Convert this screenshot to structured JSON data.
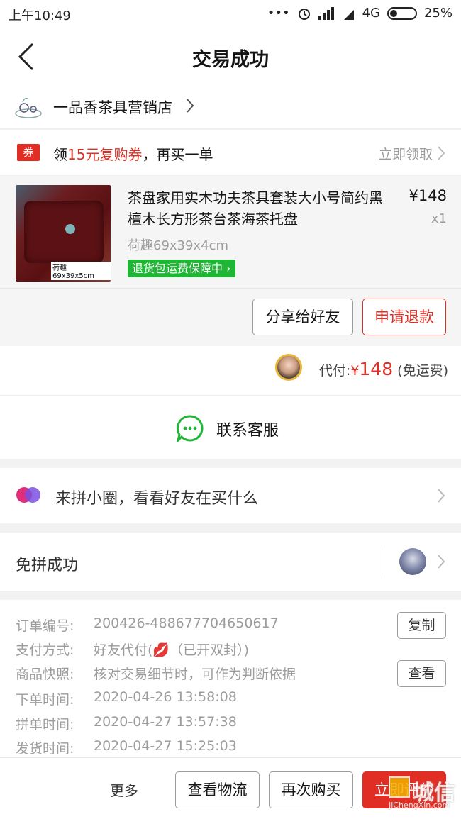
{
  "status_bar": {
    "time": "上午10:49",
    "network": "4G",
    "battery": "25%",
    "dots": "•••"
  },
  "nav": {
    "title": "交易成功"
  },
  "store": {
    "name": "一品香茶具营销店"
  },
  "coupon": {
    "tag": "券",
    "prefix": "领",
    "highlight": "15元复购券",
    "suffix": "，再买一单",
    "action": "立即领取"
  },
  "product": {
    "name": "茶盘家用实木功夫茶具套装大小号简约黑檀木长方形茶台茶海茶托盘",
    "price": "¥148",
    "quantity": "x1",
    "spec": "荷趣69x39x4cm",
    "guarantee": "退货包运费保障中",
    "image_caption": "荷趣 69x39x5cm",
    "share_label": "分享给好友",
    "refund_label": "申请退款"
  },
  "payment": {
    "label": "代付:",
    "currency": "¥",
    "amount": "148",
    "note": "(免运费)"
  },
  "contact": {
    "label": "联系客服"
  },
  "circle": {
    "label": "来拼小圈，看看好友在买什么"
  },
  "group": {
    "label": "免拼成功"
  },
  "order_info": {
    "rows": [
      {
        "label": "订单编号:",
        "value": "200426-488677704650617"
      },
      {
        "label": "支付方式:",
        "value": "好友代付(💋（已开双封）)"
      },
      {
        "label": "商品快照:",
        "value": "核对交易细节时，可作为判断依据"
      },
      {
        "label": "下单时间:",
        "value": "2020-04-26 13:58:08"
      },
      {
        "label": "拼单时间:",
        "value": "2020-04-27 13:57:38"
      },
      {
        "label": "发货时间:",
        "value": "2020-04-27 15:25:03"
      }
    ],
    "copy_label": "复制",
    "view_label": "查看"
  },
  "bottom_bar": {
    "more": "更多",
    "logistics": "查看物流",
    "rebuy": "再次购买",
    "review": "立即评价"
  },
  "watermark": {
    "big": "城信",
    "small": "JiChengXin.com"
  },
  "colors": {
    "accent": "#e02e24",
    "green": "#1fb535",
    "gray_text": "#9c9c9c"
  }
}
